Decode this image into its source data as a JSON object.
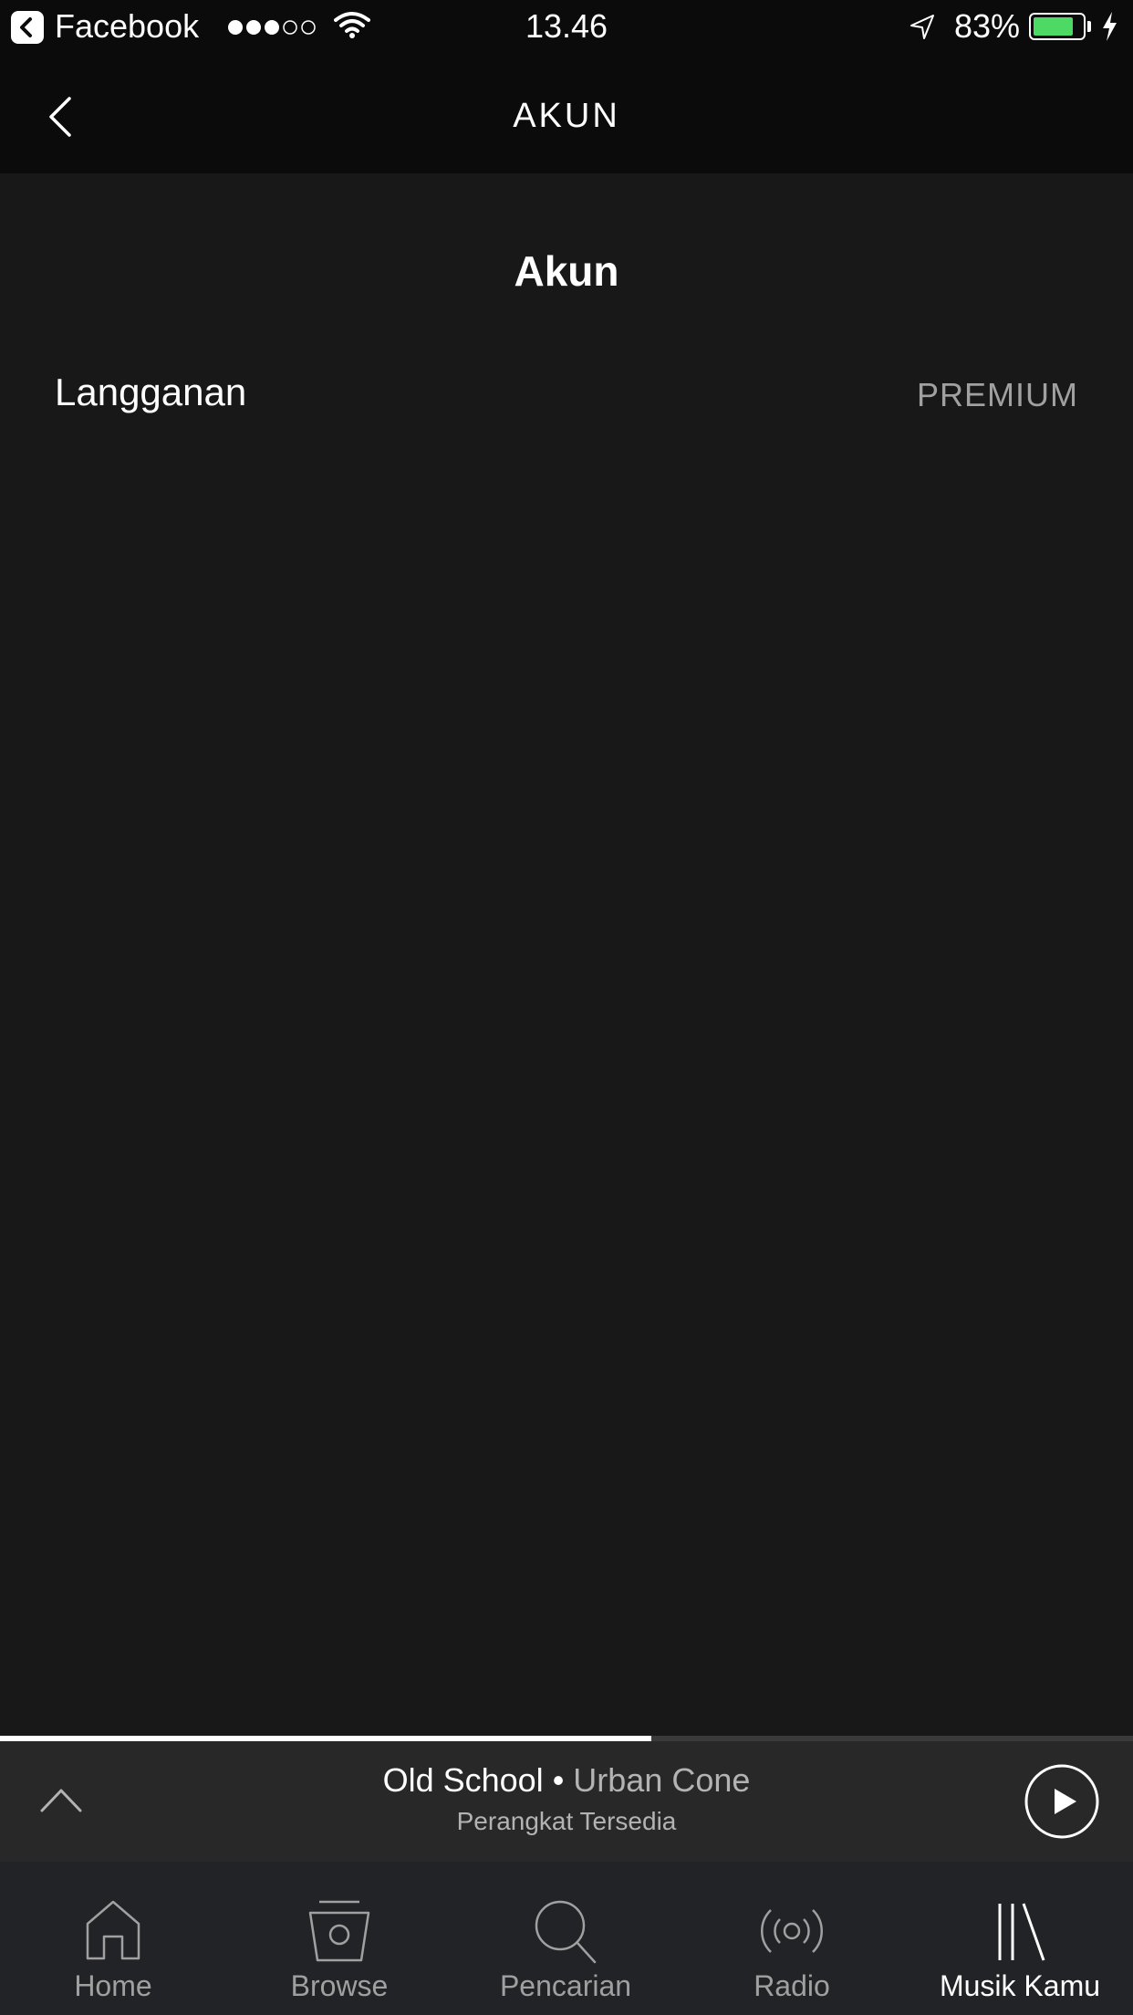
{
  "status_bar": {
    "back_app": "Facebook",
    "time": "13.46",
    "battery_percent": "83%",
    "battery_level": 0.83,
    "signal_bars_filled": 3,
    "signal_bars_total": 5
  },
  "nav": {
    "title": "AKUN"
  },
  "section": {
    "title": "Akun"
  },
  "rows": [
    {
      "label": "Langganan",
      "value": "PREMIUM"
    }
  ],
  "now_playing": {
    "track": "Old School",
    "separator": " • ",
    "artist": "Urban Cone",
    "device": "Perangkat Tersedia",
    "progress": 0.575
  },
  "tabs": [
    {
      "label": "Home",
      "icon": "home-icon",
      "active": false
    },
    {
      "label": "Browse",
      "icon": "browse-icon",
      "active": false
    },
    {
      "label": "Pencarian",
      "icon": "search-icon",
      "active": false
    },
    {
      "label": "Radio",
      "icon": "radio-icon",
      "active": false
    },
    {
      "label": "Musik Kamu",
      "icon": "library-icon",
      "active": true
    }
  ],
  "colors": {
    "background": "#181818",
    "bar": "#0b0b0b",
    "battery": "#4cd964",
    "muted_text": "#a0a0a0"
  }
}
